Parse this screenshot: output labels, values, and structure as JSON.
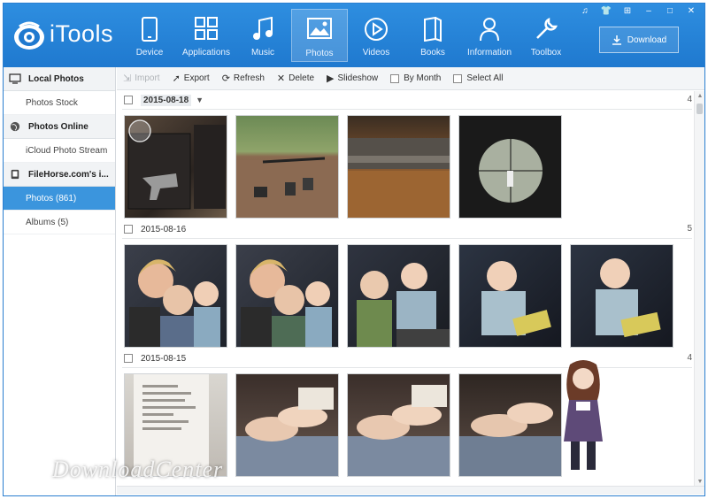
{
  "app": {
    "title": "iTools"
  },
  "nav": [
    {
      "id": "device",
      "label": "Device",
      "icon": "tablet-icon"
    },
    {
      "id": "applications",
      "label": "Applications",
      "icon": "apps-grid-icon"
    },
    {
      "id": "music",
      "label": "Music",
      "icon": "music-note-icon"
    },
    {
      "id": "photos",
      "label": "Photos",
      "icon": "photo-icon",
      "active": true
    },
    {
      "id": "videos",
      "label": "Videos",
      "icon": "play-circle-icon"
    },
    {
      "id": "books",
      "label": "Books",
      "icon": "book-icon"
    },
    {
      "id": "information",
      "label": "Information",
      "icon": "person-icon"
    },
    {
      "id": "toolbox",
      "label": "Toolbox",
      "icon": "wrench-icon"
    }
  ],
  "window_controls": [
    "♫",
    "👕",
    "⊞",
    "–",
    "□",
    "✕"
  ],
  "download_label": "Download",
  "sidebar": {
    "sections": [
      {
        "title": "Local Photos",
        "icon": "monitor-icon",
        "items": [
          {
            "label": "Photos Stock"
          }
        ]
      },
      {
        "title": "Photos Online",
        "icon": "globe-icon",
        "items": [
          {
            "label": "iCloud Photo Stream"
          }
        ]
      },
      {
        "title": "FileHorse.com's i...",
        "icon": "phone-icon",
        "items": [
          {
            "label": "Photos (861)",
            "active": true
          },
          {
            "label": "Albums (5)"
          }
        ]
      }
    ]
  },
  "toolbar": {
    "import": "Import",
    "export": "Export",
    "refresh": "Refresh",
    "delete": "Delete",
    "slideshow": "Slideshow",
    "by_month": "By Month",
    "select_all": "Select All"
  },
  "groups": [
    {
      "date": "2015-08-18",
      "count": "4"
    },
    {
      "date": "2015-08-16",
      "count": "5"
    },
    {
      "date": "2015-08-15",
      "count": "4"
    }
  ],
  "watermark": "DownloadCenter",
  "colors": {
    "header": "#1f79cf",
    "active": "#3b95dd"
  }
}
